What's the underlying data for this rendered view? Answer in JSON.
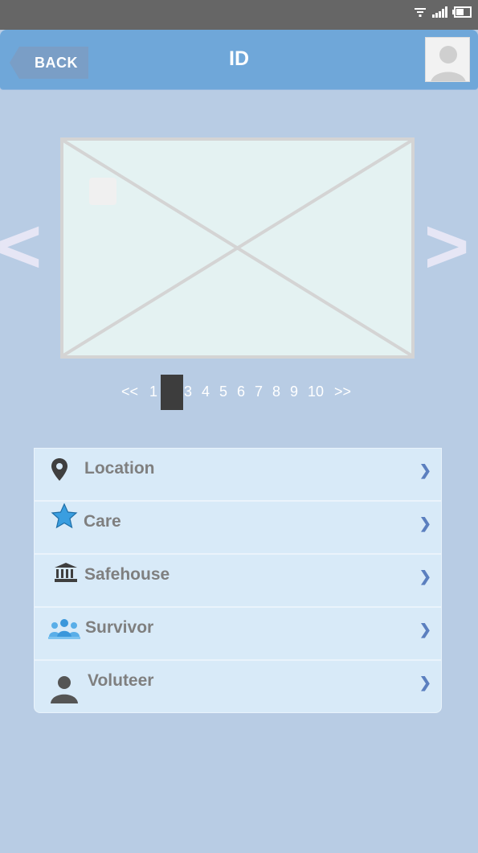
{
  "header": {
    "back_label": "BACK",
    "title": "ID"
  },
  "carousel": {
    "prev_arrow": "<",
    "next_arrow": ">",
    "pagination": {
      "first": "<<",
      "last": ">>",
      "pages": [
        "1",
        "3",
        "4",
        "5",
        "6",
        "7",
        "8",
        "9",
        "10"
      ],
      "current_page": "2"
    }
  },
  "menu": {
    "items": [
      {
        "label": "Location",
        "icon": "map-pin-icon"
      },
      {
        "label": "Care",
        "icon": "star-icon"
      },
      {
        "label": "Safehouse",
        "icon": "building-icon"
      },
      {
        "label": "Survivor",
        "icon": "people-group-icon"
      },
      {
        "label": "Voluteer",
        "icon": "person-icon"
      }
    ]
  },
  "colors": {
    "background": "#b8cce4",
    "header": "#6fa7d9",
    "menu_background": "#d8eaf8",
    "chevron": "#5b7fbf"
  }
}
